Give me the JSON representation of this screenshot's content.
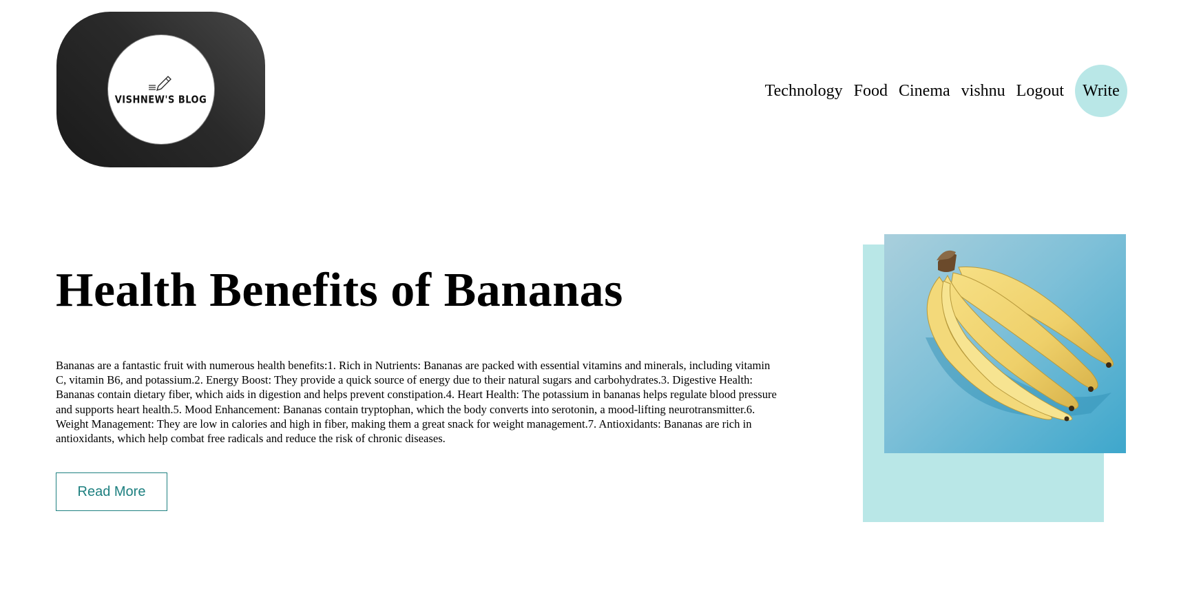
{
  "header": {
    "logo_text": "VISHNEW'S BLOG",
    "nav": [
      {
        "label": "Technology"
      },
      {
        "label": "Food"
      },
      {
        "label": "Cinema"
      },
      {
        "label": "vishnu"
      },
      {
        "label": "Logout"
      }
    ],
    "write_label": "Write"
  },
  "post": {
    "title": "Health Benefits of Bananas",
    "body": "Bananas are a fantastic fruit with numerous health benefits:1. Rich in Nutrients: Bananas are packed with essential vitamins and minerals, including vitamin C, vitamin B6, and potassium.2. Energy Boost: They provide a quick source of energy due to their natural sugars and carbohydrates.3. Digestive Health: Bananas contain dietary fiber, which aids in digestion and helps prevent constipation.4. Heart Health: The potassium in bananas helps regulate blood pressure and supports heart health.5. Mood Enhancement: Bananas contain tryptophan, which the body converts into serotonin, a mood-lifting neurotransmitter.6. Weight Management: They are low in calories and high in fiber, making them a great snack for weight management.7. Antioxidants: Bananas are rich in antioxidants, which help combat free radicals and reduce the risk of chronic diseases.",
    "read_more_label": "Read More",
    "image_icon": "bananas-photo"
  },
  "colors": {
    "accent": "#b9e7e7",
    "button_text": "#1e8080",
    "logo_bg": "#2a2a2a",
    "photo_bg": "#5fb3cf"
  }
}
